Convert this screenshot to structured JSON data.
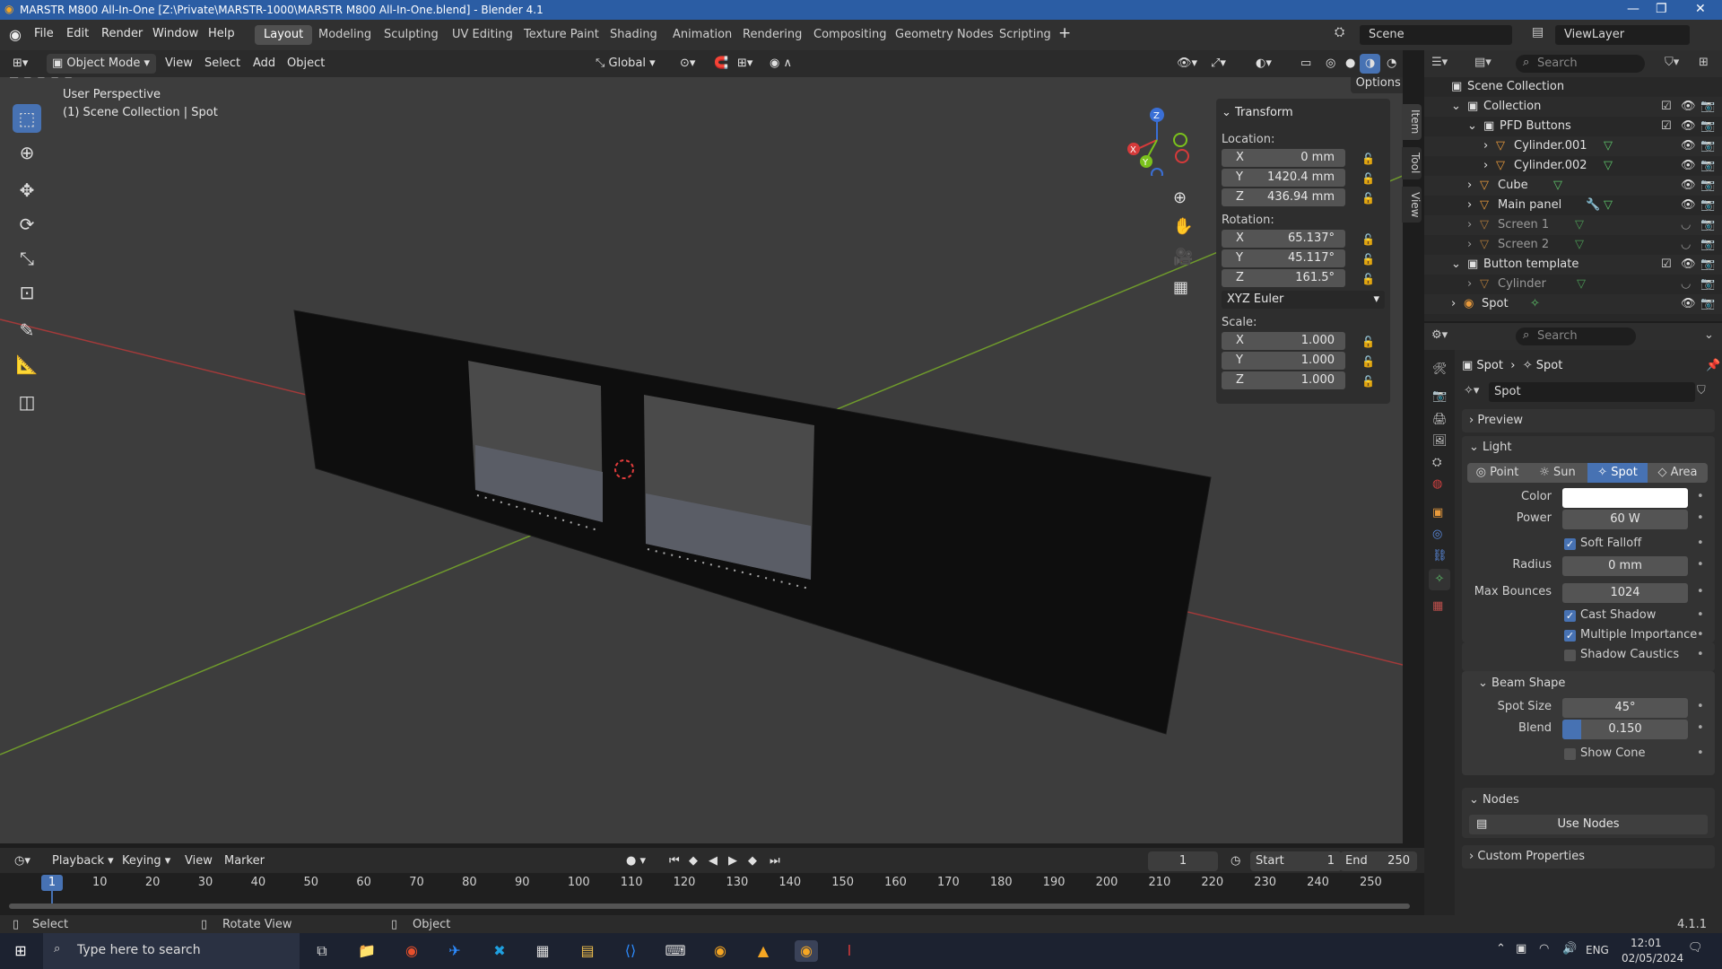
{
  "window": {
    "title": "MARSTR M800 All-In-One [Z:\\Private\\MARSTR-1000\\MARSTR M800 All-In-One.blend] - Blender 4.1"
  },
  "menu": {
    "items": [
      "File",
      "Edit",
      "Render",
      "Window",
      "Help"
    ]
  },
  "workspaces": [
    "Layout",
    "Modeling",
    "Sculpting",
    "UV Editing",
    "Texture Paint",
    "Shading",
    "Animation",
    "Rendering",
    "Compositing",
    "Geometry Nodes",
    "Scripting"
  ],
  "active_workspace": "Layout",
  "scene": {
    "name": "Scene",
    "view_layer": "ViewLayer"
  },
  "viewport_header": {
    "mode": "Object Mode",
    "menus": [
      "View",
      "Select",
      "Add",
      "Object"
    ],
    "orientation": "Global",
    "options": "Options"
  },
  "viewport": {
    "perspective": "User Perspective",
    "context": "(1) Scene Collection | Spot"
  },
  "gizmo": {
    "x": "X",
    "y": "Y",
    "z": "Z"
  },
  "transform": {
    "title": "Transform",
    "location_label": "Location:",
    "location": {
      "x": "0 mm",
      "y": "1420.4 mm",
      "z": "436.94 mm"
    },
    "rotation_label": "Rotation:",
    "rotation": {
      "x": "65.137°",
      "y": "45.117°",
      "z": "161.5°"
    },
    "rotation_mode": "XYZ Euler",
    "scale_label": "Scale:",
    "scale": {
      "x": "1.000",
      "y": "1.000",
      "z": "1.000"
    }
  },
  "side_tabs": [
    "Item",
    "Tool",
    "View"
  ],
  "outliner": {
    "search_placeholder": "Search",
    "rows": [
      {
        "label": "Scene Collection"
      },
      {
        "label": "Collection"
      },
      {
        "label": "PFD Buttons"
      },
      {
        "label": "Cylinder.001"
      },
      {
        "label": "Cylinder.002"
      },
      {
        "label": "Cube"
      },
      {
        "label": "Main panel"
      },
      {
        "label": "Screen 1"
      },
      {
        "label": "Screen 2"
      },
      {
        "label": "Button template"
      },
      {
        "label": "Cylinder"
      },
      {
        "label": "Spot"
      }
    ]
  },
  "properties": {
    "search_placeholder": "Search",
    "breadcrumb_object": "Spot",
    "breadcrumb_data": "Spot",
    "datablock": "Spot",
    "preview": "Preview",
    "light": "Light",
    "light_types": [
      "Point",
      "Sun",
      "Spot",
      "Area"
    ],
    "active_light_type": "Spot",
    "color_label": "Color",
    "color_value": "#ffffff",
    "power_label": "Power",
    "power": "60 W",
    "soft_falloff": "Soft Falloff",
    "radius_label": "Radius",
    "radius": "0 mm",
    "max_bounces_label": "Max Bounces",
    "max_bounces": "1024",
    "cast_shadow": "Cast Shadow",
    "multiple_importance": "Multiple Importance",
    "shadow_caustics": "Shadow Caustics",
    "beam_shape": "Beam Shape",
    "spot_size_label": "Spot Size",
    "spot_size": "45°",
    "blend_label": "Blend",
    "blend": "0.150",
    "blend_fraction": 0.15,
    "show_cone": "Show Cone",
    "nodes": "Nodes",
    "use_nodes": "Use Nodes",
    "custom_properties": "Custom Properties"
  },
  "timeline": {
    "menus": [
      "Playback",
      "Keying",
      "View",
      "Marker"
    ],
    "current_frame": "1",
    "start_label": "Start",
    "start": "1",
    "end_label": "End",
    "end": "250",
    "ticks": [
      "1",
      "10",
      "20",
      "30",
      "40",
      "50",
      "60",
      "70",
      "80",
      "90",
      "100",
      "110",
      "120",
      "130",
      "140",
      "150",
      "160",
      "170",
      "180",
      "190",
      "200",
      "210",
      "220",
      "230",
      "240",
      "250"
    ]
  },
  "statusbar": {
    "select": "Select",
    "rotate": "Rotate View",
    "object": "Object",
    "version": "4.1.1"
  },
  "taskbar": {
    "search_placeholder": "Type here to search",
    "lang": "ENG",
    "time": "12:01",
    "date": "02/05/2024"
  },
  "colors": {
    "accent": "#4772b3",
    "title_bar": "#2b5da4",
    "viewport_bg": "#3d3d3d"
  }
}
